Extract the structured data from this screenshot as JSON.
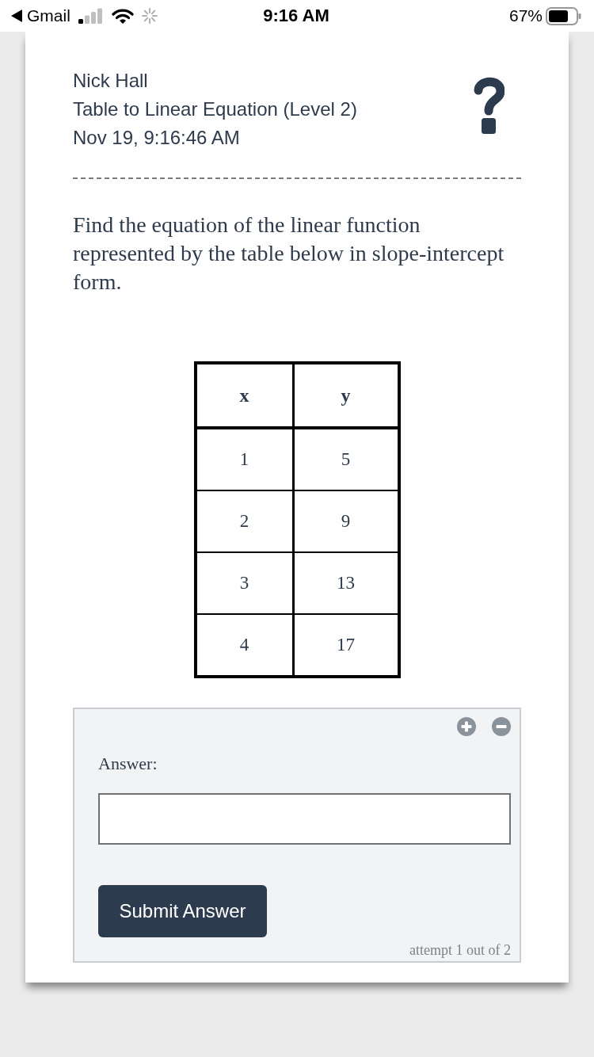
{
  "status_bar": {
    "back_label": "Gmail",
    "time": "9:16 AM",
    "battery": "67%"
  },
  "header": {
    "student": "Nick Hall",
    "assignment": "Table to Linear Equation (Level 2)",
    "timestamp": "Nov 19, 9:16:46 AM"
  },
  "question": "Find the equation of the linear function represented by the table below in slope-intercept form.",
  "table": {
    "columns": [
      "x",
      "y"
    ],
    "rows": [
      [
        "1",
        "5"
      ],
      [
        "2",
        "9"
      ],
      [
        "3",
        "13"
      ],
      [
        "4",
        "17"
      ]
    ]
  },
  "answer": {
    "label": "Answer:",
    "submit": "Submit Answer",
    "attempt": "attempt 1 out of 2"
  }
}
